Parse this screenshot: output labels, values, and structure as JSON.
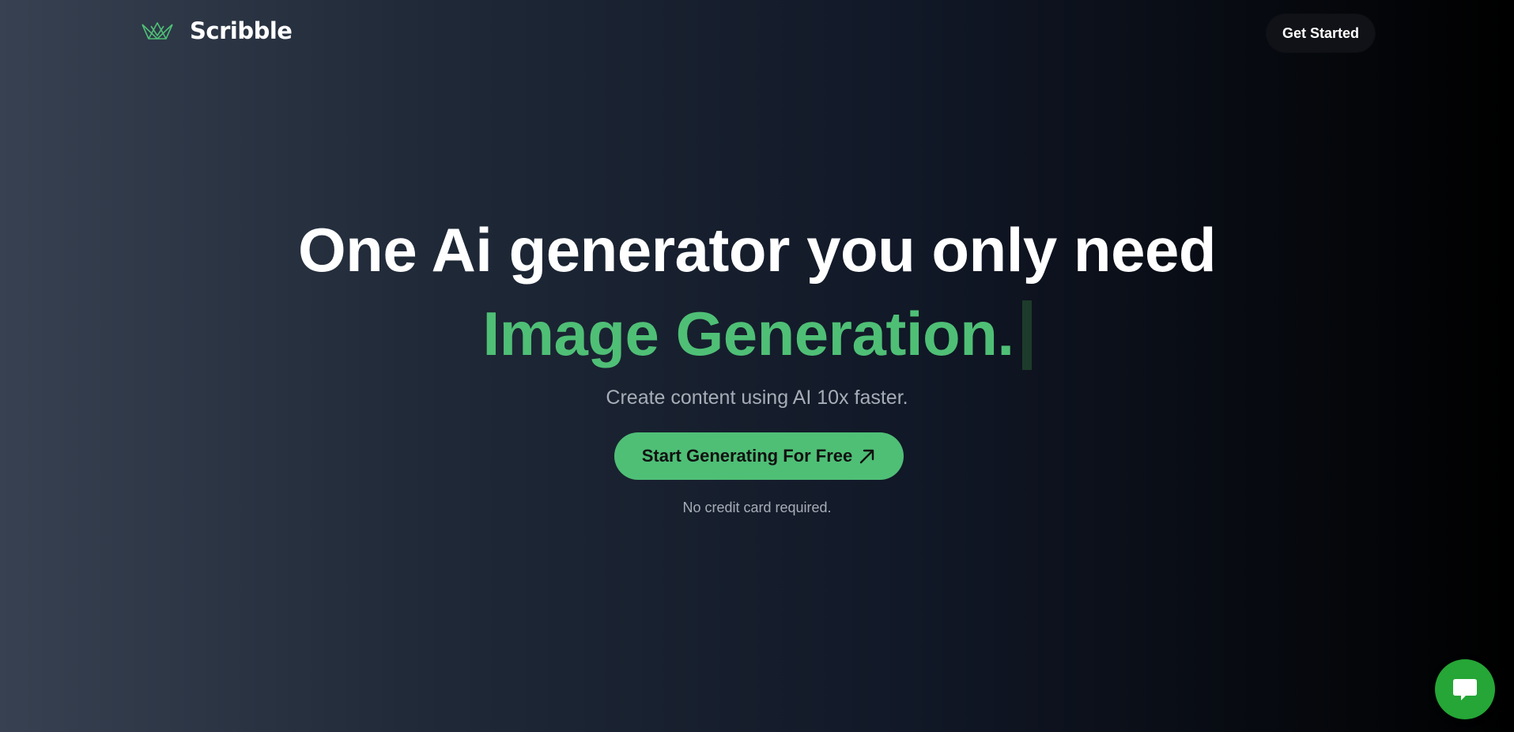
{
  "header": {
    "brand_name": "Scribble",
    "logo_icon": "crown-icon",
    "get_started_label": "Get Started"
  },
  "hero": {
    "title": "One Ai generator you only need",
    "typed_text": "Image Generation.",
    "tagline": "Create content using AI 10x faster.",
    "cta_label": "Start Generating For Free",
    "cta_icon": "arrow-up-right-icon",
    "note": "No credit card required."
  },
  "chat_widget": {
    "icon": "chat-bubble-icon"
  },
  "colors": {
    "accent": "#4fbf76",
    "chat": "#25a636",
    "button_dark": "#111217",
    "muted_text": "#a7adb7"
  }
}
